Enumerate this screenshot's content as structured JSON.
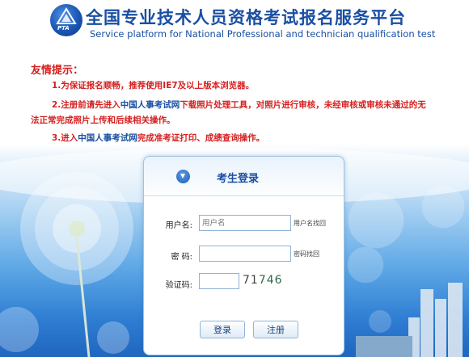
{
  "header": {
    "logo_text": "PTA",
    "title": "全国专业技术人员资格考试报名服务平台",
    "subtitle": "Service platform for National Professional and technician qualification test"
  },
  "notice": {
    "title": "友情提示：",
    "line1": "1.为保证报名顺畅，推荐使用IE7及以上版本浏览器。",
    "line2_a": "2.注册前请先进入",
    "line2_link": "中国人事考试网",
    "line2_b": "下载照片处理工具，对照片进行审核，未经审核或审核未通过的无",
    "line2_c": "法正常完成照片上传和后续相关操作。",
    "line3_a": "3.进入",
    "line3_link": "中国人事考试网",
    "line3_b": "完成准考证打印、成绩查询操作。"
  },
  "login": {
    "title": "考生登录",
    "username_label": "用户名:",
    "username_placeholder": "用户名",
    "username_forgot": "用户名找回",
    "password_label": "密  码:",
    "password_forgot": "密码找回",
    "captcha_label": "验证码:",
    "captcha_text_1": "71",
    "captcha_text_2": "746",
    "login_button": "登录",
    "register_button": "注册"
  },
  "colors": {
    "brand_blue": "#1a4fa3",
    "notice_red": "#d62020",
    "sky_bottom": "#1f66bf"
  }
}
